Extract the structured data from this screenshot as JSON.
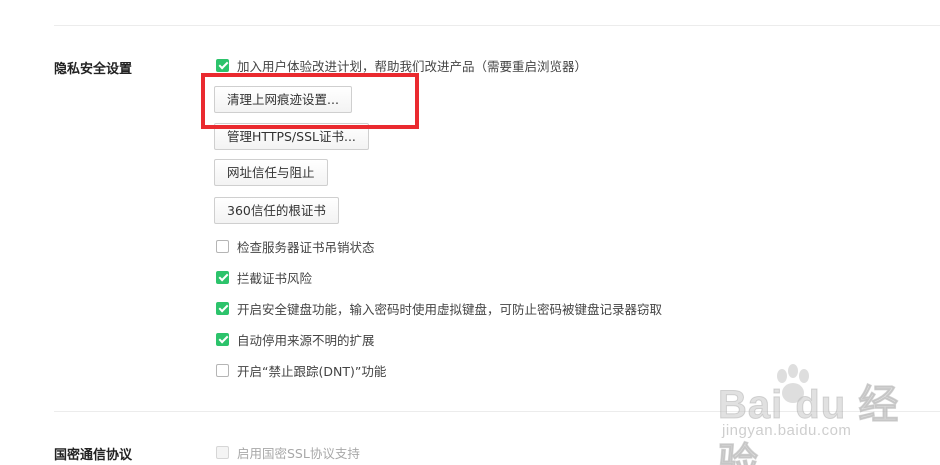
{
  "privacy": {
    "title": "隐私安全设置",
    "ux_plan_label": "加入用户体验改进计划，帮助我们改进产品（需要重启浏览器）",
    "buttons": {
      "clear_traces": "清理上网痕迹设置...",
      "manage_https": "管理HTTPS/SSL证书...",
      "url_trust": "网址信任与阻止",
      "root_cert": "360信任的根证书"
    },
    "checkboxes": [
      {
        "label": "检查服务器证书吊销状态",
        "checked": false
      },
      {
        "label": "拦截证书风险",
        "checked": true
      },
      {
        "label": "开启安全键盘功能，输入密码时使用虚拟键盘，可防止密码被键盘记录器窃取",
        "checked": true
      },
      {
        "label": "自动停用来源不明的扩展",
        "checked": true
      },
      {
        "label": "开启“禁止跟踪(DNT)”功能",
        "checked": false
      }
    ]
  },
  "gm_protocol": {
    "title": "国密通信协议",
    "ssl_label": "启用国密SSL协议支持",
    "checked": false,
    "disabled": true
  },
  "watermark": {
    "logo": "Bai du 经验",
    "url": "jingyan.baidu.com"
  },
  "colors": {
    "checkbox_checked": "#2cc36b",
    "highlight": "#ea2a2f"
  }
}
